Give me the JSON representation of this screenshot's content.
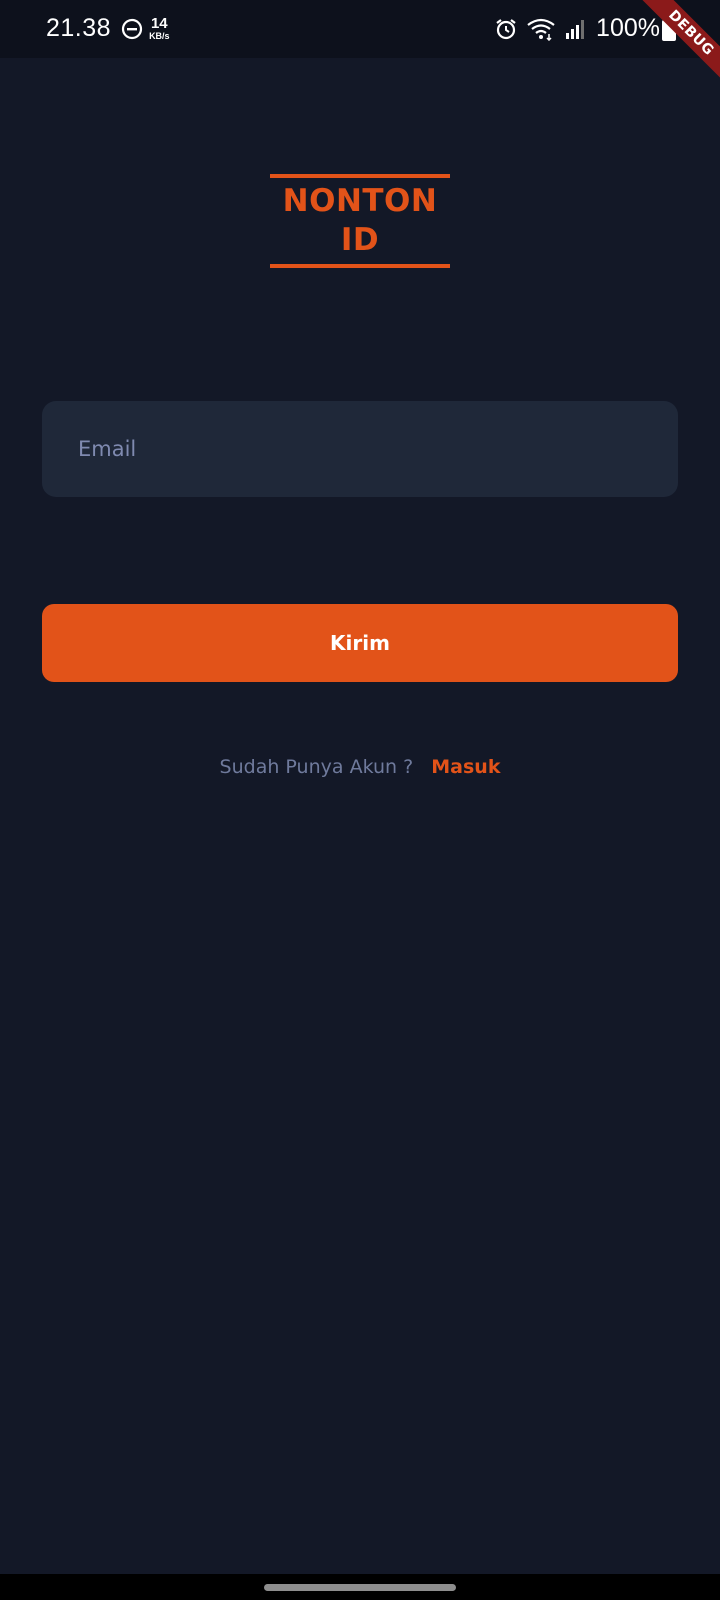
{
  "status_bar": {
    "time": "21.38",
    "net_speed_value": "14",
    "net_speed_unit": "KB/s",
    "battery": "100%",
    "icons": [
      "dnd-icon",
      "alarm-icon",
      "wifi-icon",
      "signal-icon",
      "battery-icon"
    ]
  },
  "debug_banner": "DEBUG",
  "logo": {
    "line1": "NONTON",
    "line2": "ID",
    "color": "#e25319"
  },
  "form": {
    "email_placeholder": "Email",
    "submit_label": "Kirim"
  },
  "footer": {
    "question": "Sudah Punya Akun ?",
    "login_link": "Masuk"
  },
  "colors": {
    "background": "#131827",
    "input_background": "#1f2839",
    "accent": "#e25319",
    "muted_text": "#6f7a9c"
  }
}
